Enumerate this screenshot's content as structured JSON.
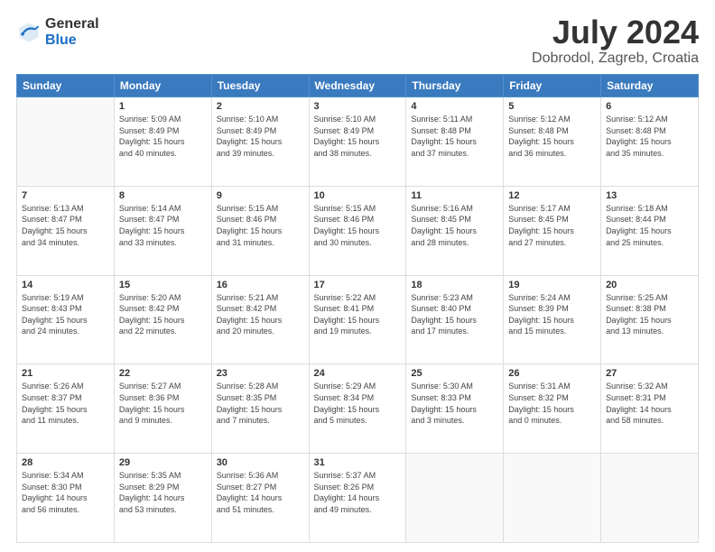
{
  "logo": {
    "general": "General",
    "blue": "Blue"
  },
  "title": {
    "month_year": "July 2024",
    "location": "Dobrodol, Zagreb, Croatia"
  },
  "days_of_week": [
    "Sunday",
    "Monday",
    "Tuesday",
    "Wednesday",
    "Thursday",
    "Friday",
    "Saturday"
  ],
  "weeks": [
    [
      {
        "day": "",
        "info": ""
      },
      {
        "day": "1",
        "info": "Sunrise: 5:09 AM\nSunset: 8:49 PM\nDaylight: 15 hours\nand 40 minutes."
      },
      {
        "day": "2",
        "info": "Sunrise: 5:10 AM\nSunset: 8:49 PM\nDaylight: 15 hours\nand 39 minutes."
      },
      {
        "day": "3",
        "info": "Sunrise: 5:10 AM\nSunset: 8:49 PM\nDaylight: 15 hours\nand 38 minutes."
      },
      {
        "day": "4",
        "info": "Sunrise: 5:11 AM\nSunset: 8:48 PM\nDaylight: 15 hours\nand 37 minutes."
      },
      {
        "day": "5",
        "info": "Sunrise: 5:12 AM\nSunset: 8:48 PM\nDaylight: 15 hours\nand 36 minutes."
      },
      {
        "day": "6",
        "info": "Sunrise: 5:12 AM\nSunset: 8:48 PM\nDaylight: 15 hours\nand 35 minutes."
      }
    ],
    [
      {
        "day": "7",
        "info": "Sunrise: 5:13 AM\nSunset: 8:47 PM\nDaylight: 15 hours\nand 34 minutes."
      },
      {
        "day": "8",
        "info": "Sunrise: 5:14 AM\nSunset: 8:47 PM\nDaylight: 15 hours\nand 33 minutes."
      },
      {
        "day": "9",
        "info": "Sunrise: 5:15 AM\nSunset: 8:46 PM\nDaylight: 15 hours\nand 31 minutes."
      },
      {
        "day": "10",
        "info": "Sunrise: 5:15 AM\nSunset: 8:46 PM\nDaylight: 15 hours\nand 30 minutes."
      },
      {
        "day": "11",
        "info": "Sunrise: 5:16 AM\nSunset: 8:45 PM\nDaylight: 15 hours\nand 28 minutes."
      },
      {
        "day": "12",
        "info": "Sunrise: 5:17 AM\nSunset: 8:45 PM\nDaylight: 15 hours\nand 27 minutes."
      },
      {
        "day": "13",
        "info": "Sunrise: 5:18 AM\nSunset: 8:44 PM\nDaylight: 15 hours\nand 25 minutes."
      }
    ],
    [
      {
        "day": "14",
        "info": "Sunrise: 5:19 AM\nSunset: 8:43 PM\nDaylight: 15 hours\nand 24 minutes."
      },
      {
        "day": "15",
        "info": "Sunrise: 5:20 AM\nSunset: 8:42 PM\nDaylight: 15 hours\nand 22 minutes."
      },
      {
        "day": "16",
        "info": "Sunrise: 5:21 AM\nSunset: 8:42 PM\nDaylight: 15 hours\nand 20 minutes."
      },
      {
        "day": "17",
        "info": "Sunrise: 5:22 AM\nSunset: 8:41 PM\nDaylight: 15 hours\nand 19 minutes."
      },
      {
        "day": "18",
        "info": "Sunrise: 5:23 AM\nSunset: 8:40 PM\nDaylight: 15 hours\nand 17 minutes."
      },
      {
        "day": "19",
        "info": "Sunrise: 5:24 AM\nSunset: 8:39 PM\nDaylight: 15 hours\nand 15 minutes."
      },
      {
        "day": "20",
        "info": "Sunrise: 5:25 AM\nSunset: 8:38 PM\nDaylight: 15 hours\nand 13 minutes."
      }
    ],
    [
      {
        "day": "21",
        "info": "Sunrise: 5:26 AM\nSunset: 8:37 PM\nDaylight: 15 hours\nand 11 minutes."
      },
      {
        "day": "22",
        "info": "Sunrise: 5:27 AM\nSunset: 8:36 PM\nDaylight: 15 hours\nand 9 minutes."
      },
      {
        "day": "23",
        "info": "Sunrise: 5:28 AM\nSunset: 8:35 PM\nDaylight: 15 hours\nand 7 minutes."
      },
      {
        "day": "24",
        "info": "Sunrise: 5:29 AM\nSunset: 8:34 PM\nDaylight: 15 hours\nand 5 minutes."
      },
      {
        "day": "25",
        "info": "Sunrise: 5:30 AM\nSunset: 8:33 PM\nDaylight: 15 hours\nand 3 minutes."
      },
      {
        "day": "26",
        "info": "Sunrise: 5:31 AM\nSunset: 8:32 PM\nDaylight: 15 hours\nand 0 minutes."
      },
      {
        "day": "27",
        "info": "Sunrise: 5:32 AM\nSunset: 8:31 PM\nDaylight: 14 hours\nand 58 minutes."
      }
    ],
    [
      {
        "day": "28",
        "info": "Sunrise: 5:34 AM\nSunset: 8:30 PM\nDaylight: 14 hours\nand 56 minutes."
      },
      {
        "day": "29",
        "info": "Sunrise: 5:35 AM\nSunset: 8:29 PM\nDaylight: 14 hours\nand 53 minutes."
      },
      {
        "day": "30",
        "info": "Sunrise: 5:36 AM\nSunset: 8:27 PM\nDaylight: 14 hours\nand 51 minutes."
      },
      {
        "day": "31",
        "info": "Sunrise: 5:37 AM\nSunset: 8:26 PM\nDaylight: 14 hours\nand 49 minutes."
      },
      {
        "day": "",
        "info": ""
      },
      {
        "day": "",
        "info": ""
      },
      {
        "day": "",
        "info": ""
      }
    ]
  ]
}
